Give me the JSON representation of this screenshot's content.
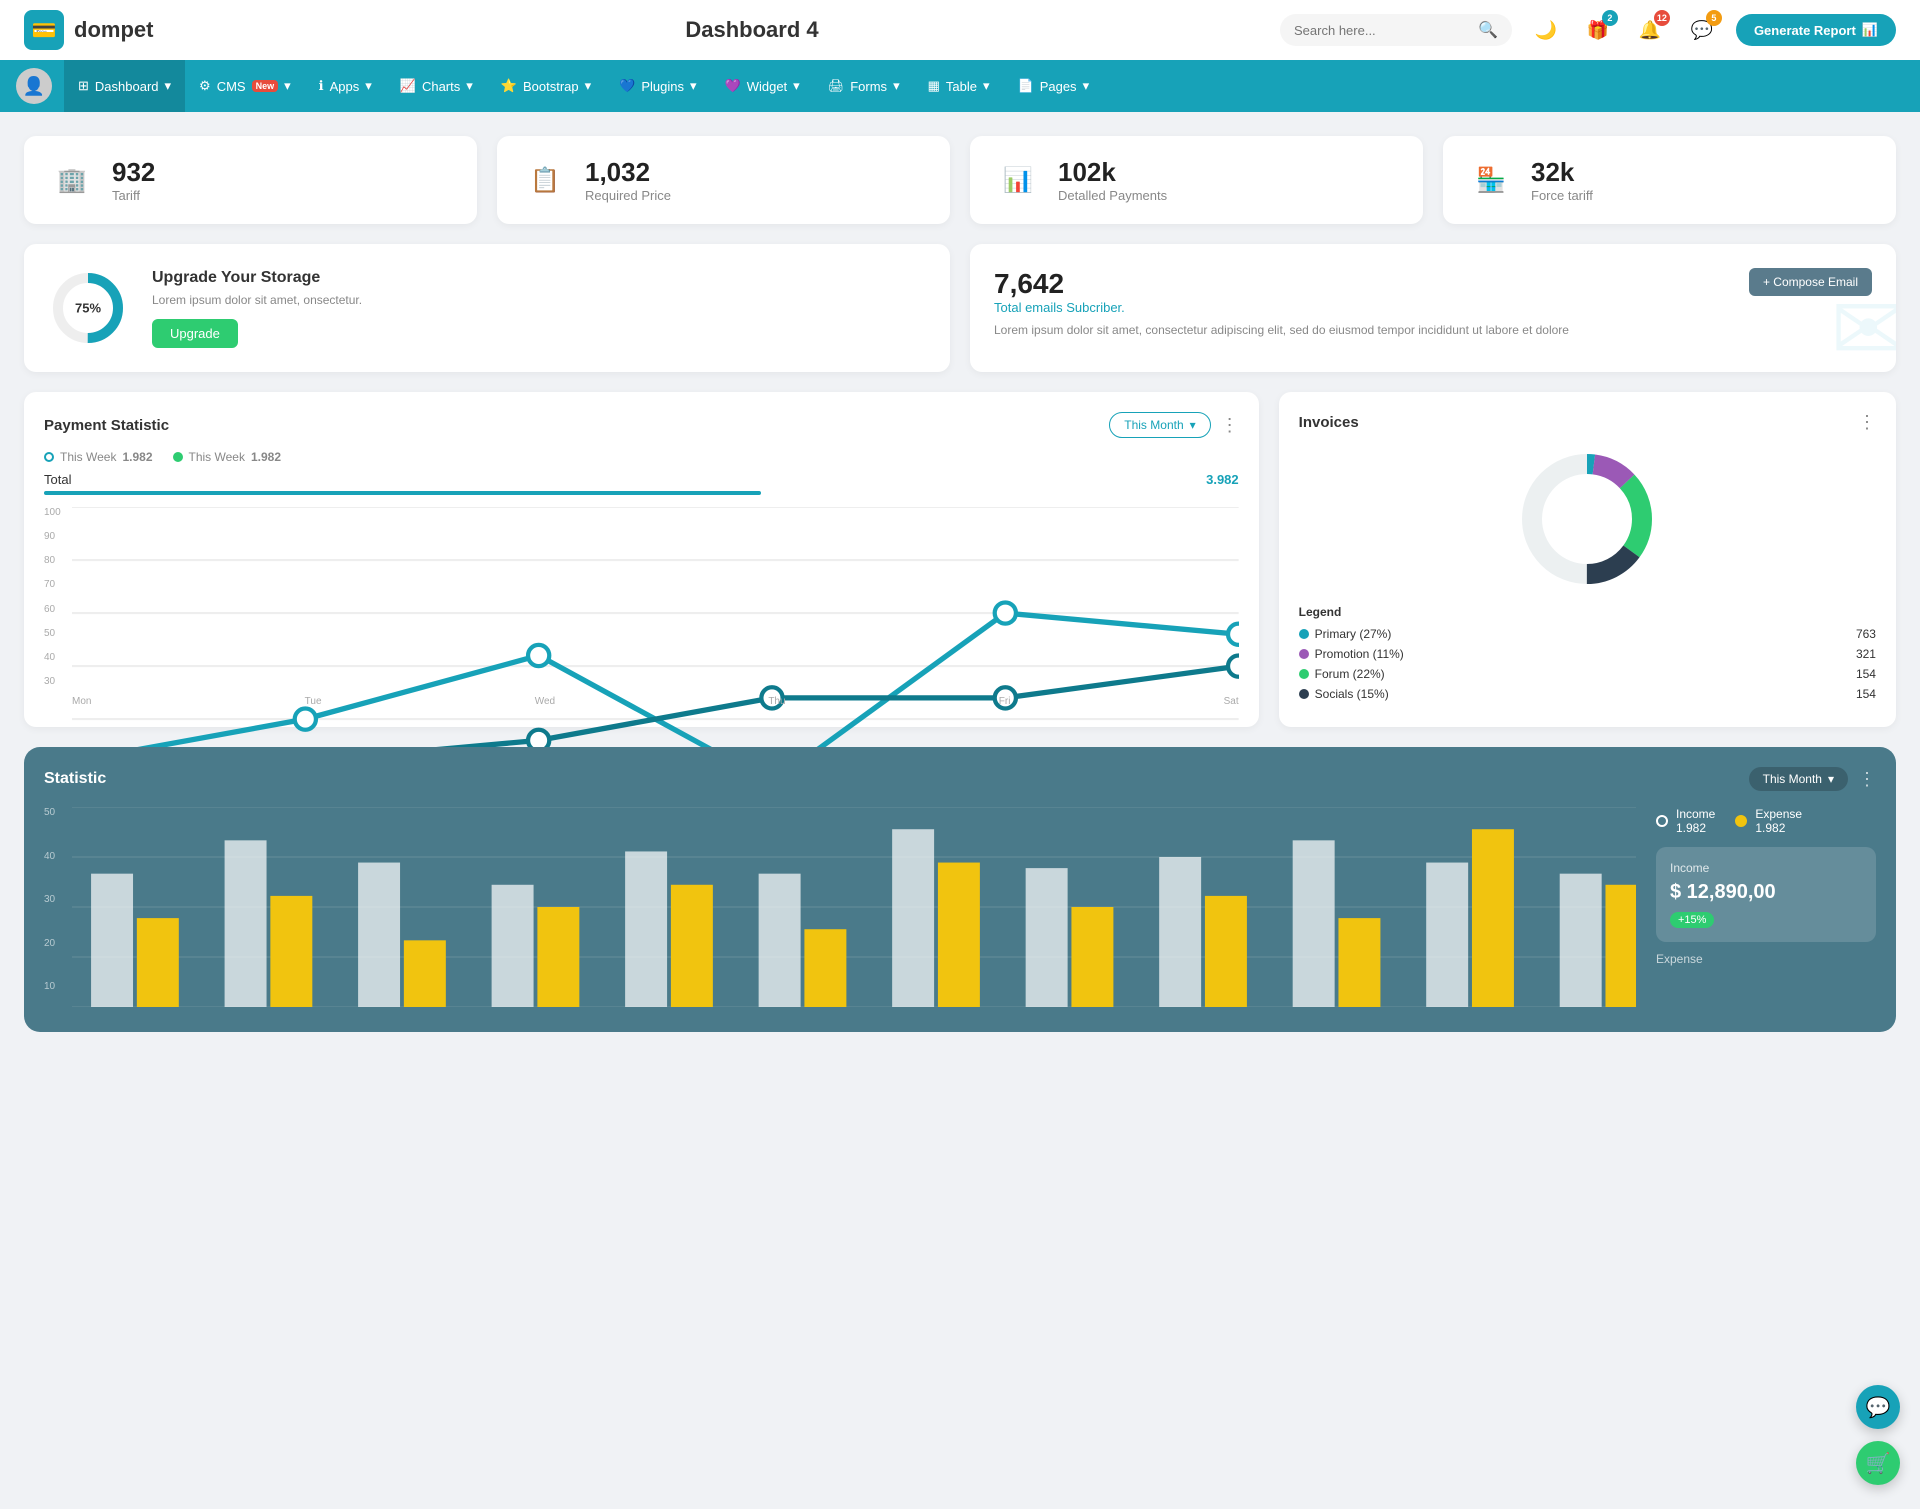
{
  "header": {
    "logo_icon": "💳",
    "logo_text": "dompet",
    "page_title": "Dashboard 4",
    "search_placeholder": "Search here...",
    "generate_btn_label": "Generate Report",
    "icons": {
      "search": "🔍",
      "moon": "🌙",
      "gift": "🎁",
      "bell": "🔔",
      "chat": "💬"
    },
    "badges": {
      "gift": "2",
      "bell": "12",
      "chat": "5"
    }
  },
  "nav": {
    "avatar_icon": "👤",
    "items": [
      {
        "label": "Dashboard",
        "icon": "⊞",
        "active": true,
        "has_arrow": true
      },
      {
        "label": "CMS",
        "icon": "⚙",
        "active": false,
        "has_arrow": true,
        "badge": "New"
      },
      {
        "label": "Apps",
        "icon": "ℹ",
        "active": false,
        "has_arrow": true
      },
      {
        "label": "Charts",
        "icon": "📈",
        "active": false,
        "has_arrow": true
      },
      {
        "label": "Bootstrap",
        "icon": "⭐",
        "active": false,
        "has_arrow": true
      },
      {
        "label": "Plugins",
        "icon": "💙",
        "active": false,
        "has_arrow": true
      },
      {
        "label": "Widget",
        "icon": "💜",
        "active": false,
        "has_arrow": true
      },
      {
        "label": "Forms",
        "icon": "🖨",
        "active": false,
        "has_arrow": true
      },
      {
        "label": "Table",
        "icon": "▦",
        "active": false,
        "has_arrow": true
      },
      {
        "label": "Pages",
        "icon": "📄",
        "active": false,
        "has_arrow": true
      }
    ]
  },
  "stat_cards": [
    {
      "icon": "🏢",
      "icon_color": "teal",
      "value": "932",
      "label": "Tariff"
    },
    {
      "icon": "📋",
      "icon_color": "red",
      "value": "1,032",
      "label": "Required Price"
    },
    {
      "icon": "📊",
      "icon_color": "purple",
      "value": "102k",
      "label": "Detalled Payments"
    },
    {
      "icon": "🏪",
      "icon_color": "pink",
      "value": "32k",
      "label": "Force tariff"
    }
  ],
  "storage": {
    "percent": 75,
    "title": "Upgrade Your Storage",
    "description": "Lorem ipsum dolor sit amet, onsectetur.",
    "button_label": "Upgrade"
  },
  "email_card": {
    "value": "7,642",
    "label": "Total emails Subcriber.",
    "description": "Lorem ipsum dolor sit amet, consectetur adipiscing elit, sed do eiusmod tempor incididunt ut labore et dolore",
    "compose_btn": "+ Compose Email"
  },
  "payment": {
    "title": "Payment Statistic",
    "filter_label": "This Month",
    "legend": [
      {
        "label": "This Week",
        "value": "1.982"
      },
      {
        "label": "This Week",
        "value": "1.982"
      }
    ],
    "total_label": "Total",
    "total_value": "3.982",
    "x_labels": [
      "Mon",
      "Tue",
      "Wed",
      "Thu",
      "Fri",
      "Sat"
    ],
    "y_labels": [
      "100",
      "90",
      "80",
      "70",
      "60",
      "50",
      "40",
      "30"
    ],
    "line1_points": "0,40 90,40 180,25 270,40 360,35 450,40",
    "line2_points": "0,20 90,30 180,15 270,20 360,10 450,15"
  },
  "invoices": {
    "title": "Invoices",
    "legend": [
      {
        "label": "Primary (27%)",
        "value": "763",
        "color": "#17a2b8"
      },
      {
        "label": "Promotion (11%)",
        "value": "321",
        "color": "#9b59b6"
      },
      {
        "label": "Forum (22%)",
        "value": "154",
        "color": "#2ecc71"
      },
      {
        "label": "Socials (15%)",
        "value": "154",
        "color": "#2c3e50"
      }
    ],
    "donut": {
      "segments": [
        {
          "percent": 27,
          "color": "#17a2b8"
        },
        {
          "percent": 11,
          "color": "#9b59b6"
        },
        {
          "percent": 22,
          "color": "#2ecc71"
        },
        {
          "percent": 15,
          "color": "#2c3e50"
        },
        {
          "percent": 25,
          "color": "#ecf0f1"
        }
      ]
    }
  },
  "statistic": {
    "title": "Statistic",
    "filter_label": "This Month",
    "y_labels": [
      "50",
      "40",
      "30",
      "20",
      "10"
    ],
    "income": {
      "legend_label": "Income",
      "legend_value": "1.982",
      "label": "Income",
      "value": "$ 12,890,00",
      "change": "+15%"
    },
    "expense": {
      "legend_label": "Expense",
      "legend_value": "1.982",
      "label": "Expense"
    }
  }
}
